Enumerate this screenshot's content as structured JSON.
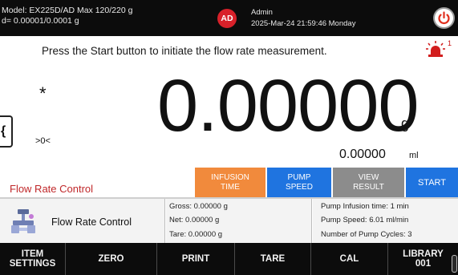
{
  "header": {
    "model_line": "Model: EX225D/AD   Max 120/220 g",
    "resolution_line": "d= 0.00001/0.0001 g",
    "avatar_initials": "AD",
    "user_name": "Admin",
    "datetime": "2025-Mar-24 21:59:46 Monday",
    "avatar_color": "#d8212a"
  },
  "message": "Press the Start button to initiate the flow rate measurement.",
  "alarm": {
    "icon": "alarm-siren-icon",
    "count": "1"
  },
  "weight": {
    "stability_mark": "*",
    "zero_indicator": ">0<",
    "value": "0.00000",
    "unit": "g",
    "secondary_value": "0.00000",
    "secondary_unit": "ml",
    "side_tab_glyph": "{"
  },
  "mode_label": "Flow Rate Control",
  "controls": {
    "infusion": "INFUSION\nTIME",
    "pump": "PUMP\nSPEED",
    "view": "VIEW\nRESULT",
    "start": "START"
  },
  "application": {
    "name": "Flow Rate Control",
    "icon": "flow-rate-icon"
  },
  "weights_info": {
    "gross": "Gross: 0.00000 g",
    "net": "Net: 0.00000 g",
    "tare": "Tare: 0.00000 g"
  },
  "pump_info": {
    "infusion_time": "Pump Infusion time: 1 min",
    "speed": "Pump Speed: 6.01 ml/min",
    "cycles": "Number of Pump Cycles: 3"
  },
  "function_keys": [
    "ITEM\nSETTINGS",
    "ZERO",
    "PRINT",
    "TARE",
    "CAL",
    "LIBRARY\n001"
  ],
  "colors": {
    "infusion_button": "#f18a3c",
    "accent_blue": "#1f74e0",
    "view_button": "#8c8c8c",
    "mode_label": "#c0282a"
  }
}
